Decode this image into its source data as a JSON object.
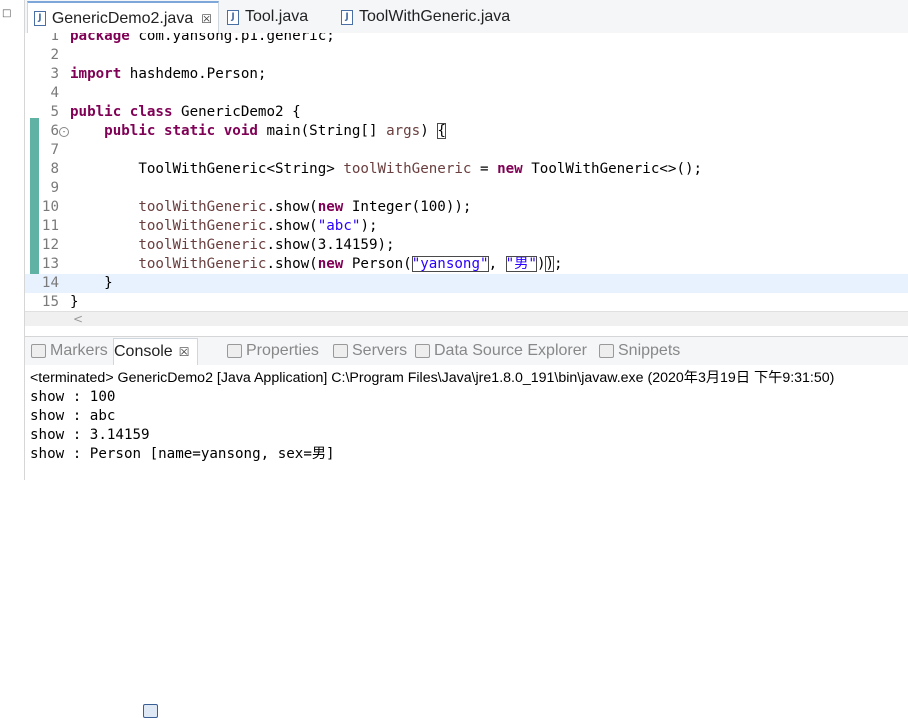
{
  "editor_tabs": [
    {
      "label": "GenericDemo2.java",
      "close": "☒"
    },
    {
      "label": "Tool.java"
    },
    {
      "label": "ToolWithGeneric.java"
    }
  ],
  "code_lines": [
    {
      "n": "1",
      "segs": [
        {
          "t": "package",
          "c": "kw"
        },
        {
          "t": " com.yansong.p1.generic;"
        }
      ]
    },
    {
      "n": "2",
      "segs": []
    },
    {
      "n": "3",
      "segs": [
        {
          "t": "import",
          "c": "kw"
        },
        {
          "t": " hashdemo.Person;"
        }
      ]
    },
    {
      "n": "4",
      "segs": []
    },
    {
      "n": "5",
      "segs": [
        {
          "t": "public",
          "c": "kw"
        },
        {
          "t": " "
        },
        {
          "t": "class",
          "c": "kw"
        },
        {
          "t": " GenericDemo2 {"
        }
      ]
    },
    {
      "n": "6",
      "segs": [
        {
          "t": "    "
        },
        {
          "t": "public",
          "c": "kw"
        },
        {
          "t": " "
        },
        {
          "t": "static",
          "c": "kw"
        },
        {
          "t": " "
        },
        {
          "t": "void",
          "c": "kw"
        },
        {
          "t": " main(String[] "
        },
        {
          "t": "args",
          "c": "var"
        },
        {
          "t": ") "
        },
        {
          "t": "{",
          "c": "boxed"
        }
      ]
    },
    {
      "n": "7",
      "segs": []
    },
    {
      "n": "8",
      "segs": [
        {
          "t": "        ToolWithGeneric<String> "
        },
        {
          "t": "toolWithGeneric",
          "c": "var"
        },
        {
          "t": " = "
        },
        {
          "t": "new",
          "c": "kw"
        },
        {
          "t": " ToolWithGeneric<>();"
        }
      ]
    },
    {
      "n": "9",
      "segs": []
    },
    {
      "n": "10",
      "segs": [
        {
          "t": "        "
        },
        {
          "t": "toolWithGeneric",
          "c": "var"
        },
        {
          "t": ".show("
        },
        {
          "t": "new",
          "c": "kw"
        },
        {
          "t": " Integer(100));"
        }
      ]
    },
    {
      "n": "11",
      "segs": [
        {
          "t": "        "
        },
        {
          "t": "toolWithGeneric",
          "c": "var"
        },
        {
          "t": ".show("
        },
        {
          "t": "\"abc\"",
          "c": "str"
        },
        {
          "t": ");"
        }
      ]
    },
    {
      "n": "12",
      "segs": [
        {
          "t": "        "
        },
        {
          "t": "toolWithGeneric",
          "c": "var"
        },
        {
          "t": ".show(3.14159);"
        }
      ]
    },
    {
      "n": "13",
      "segs": [
        {
          "t": "        "
        },
        {
          "t": "toolWithGeneric",
          "c": "var"
        },
        {
          "t": ".show("
        },
        {
          "t": "new",
          "c": "kw"
        },
        {
          "t": " Person("
        },
        {
          "t": "\"yansong\"",
          "c": "str boxed"
        },
        {
          "t": ", "
        },
        {
          "t": "\"男\"",
          "c": "str boxed"
        },
        {
          "t": ")"
        },
        {
          "t": ")",
          "c": "boxed"
        },
        {
          "t": ";"
        }
      ]
    },
    {
      "n": "14",
      "segs": [
        {
          "t": "    }"
        }
      ],
      "current": true
    },
    {
      "n": "15",
      "segs": [
        {
          "t": "}"
        }
      ]
    }
  ],
  "fold_marker": "-",
  "scroll_arrow": "<",
  "left_gutter_glyph": "□",
  "panel_tabs": [
    {
      "label": "Markers",
      "icon": "markers-icon"
    },
    {
      "label": "Console",
      "icon": "console-icon",
      "active": true,
      "close": "☒"
    },
    {
      "label": "Properties",
      "icon": "properties-icon"
    },
    {
      "label": "Servers",
      "icon": "servers-icon"
    },
    {
      "label": "Data Source Explorer",
      "icon": "database-icon"
    },
    {
      "label": "Snippets",
      "icon": "snippets-icon"
    }
  ],
  "console": {
    "terminated": "<terminated> GenericDemo2 [Java Application] C:\\Program Files\\Java\\jre1.8.0_191\\bin\\javaw.exe (2020年3月19日 下午9:31:50)",
    "output": [
      "show : 100",
      "show : abc",
      "show : 3.14159",
      "show : Person [name=yansong, sex=男]"
    ]
  }
}
